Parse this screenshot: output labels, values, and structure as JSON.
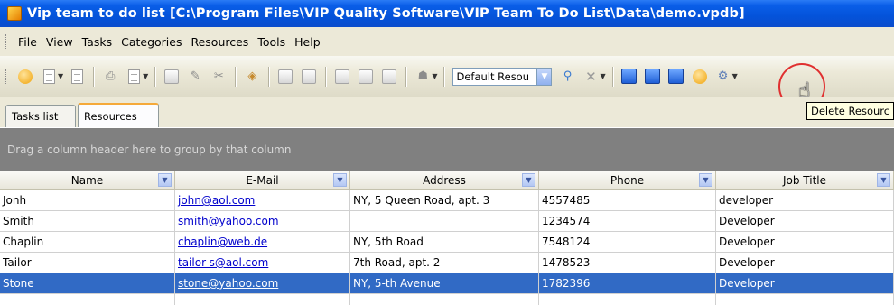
{
  "window": {
    "title": "Vip team to do list [C:\\Program Files\\VIP Quality Software\\VIP Team To Do List\\Data\\demo.vpdb]"
  },
  "menu": [
    "File",
    "View",
    "Tasks",
    "Categories",
    "Resources",
    "Tools",
    "Help"
  ],
  "toolbar": {
    "resource_combo_value": "Default Resou",
    "tooltip": "Delete Resourc"
  },
  "tabs": [
    {
      "label": "Tasks list",
      "active": false
    },
    {
      "label": "Resources",
      "active": true
    }
  ],
  "group_panel": {
    "text": "Drag a column header here to group by that column"
  },
  "grid": {
    "columns": [
      "Name",
      "E-Mail",
      "Address",
      "Phone",
      "Job Title"
    ],
    "rows": [
      {
        "name": "Jonh",
        "email": "john@aol.com",
        "address": "NY, 5 Queen Road, apt. 3",
        "phone": "4557485",
        "job": "developer"
      },
      {
        "name": "Smith",
        "email": "smith@yahoo.com",
        "address": "",
        "phone": "1234574",
        "job": "Developer"
      },
      {
        "name": "Chaplin",
        "email": "chaplin@web.de",
        "address": "NY, 5th Road",
        "phone": "7548124",
        "job": "Developer"
      },
      {
        "name": "Tailor",
        "email": "tailor-s@aol.com",
        "address": "7th Road, apt. 2",
        "phone": "1478523",
        "job": "Developer"
      },
      {
        "name": "Stone",
        "email": "stone@yahoo.com",
        "address": "NY, 5-th Avenue",
        "phone": "1782396",
        "job": "Developer",
        "selected": true
      }
    ]
  },
  "colors": {
    "selection": "#316ac5",
    "title_bar": "#0453da",
    "highlight_circle": "#e03030"
  }
}
